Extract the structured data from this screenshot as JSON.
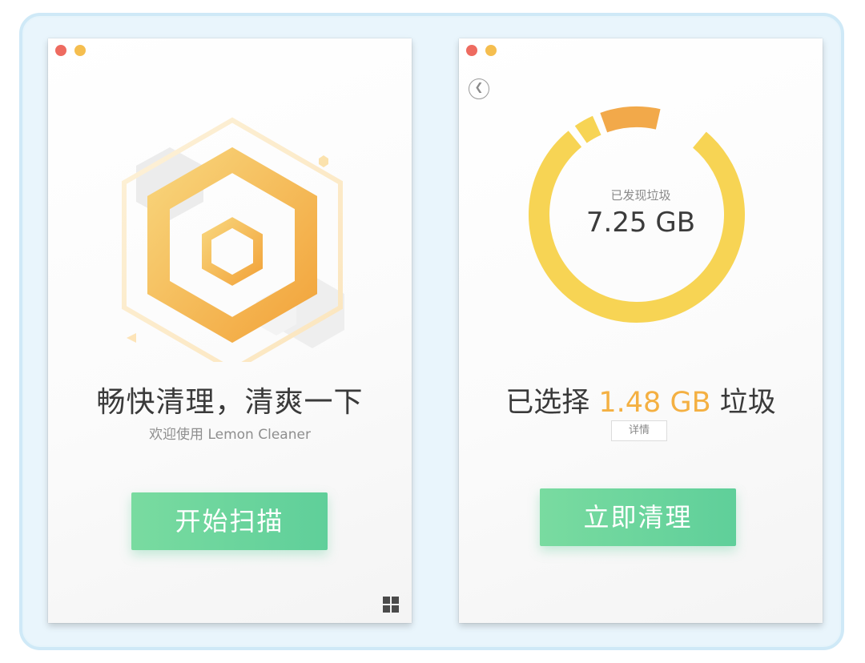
{
  "colors": {
    "close_dot": "#ee6b60",
    "minimize_dot": "#f5be4f",
    "accent_green": "#5fcf9a",
    "accent_yellow": "#f4b042",
    "ring_yellow": "#f7d454",
    "ring_orange": "#f2a94a"
  },
  "welcome_window": {
    "slogan": "畅快清理，清爽一下",
    "welcome_text": "欢迎使用 Lemon Cleaner",
    "start_scan_button": "开始扫描",
    "icons": [
      "lemon-hexagon-logo-icon",
      "grid-menu-icon"
    ]
  },
  "result_window": {
    "found_label": "已发现垃圾",
    "found_size": "7.25 GB",
    "selected_prefix": "已选择",
    "selected_amount": "1.48 GB",
    "selected_suffix": "垃圾",
    "details_button": "详情",
    "clean_now_button": "立即清理",
    "icons": [
      "back-chevron-icon"
    ],
    "ring_segments": [
      {
        "color": "#f7d454",
        "fraction": 0.78
      },
      {
        "color": "#f7d454",
        "fraction": 0.03
      },
      {
        "color": "#f2a94a",
        "fraction": 0.09
      }
    ]
  }
}
